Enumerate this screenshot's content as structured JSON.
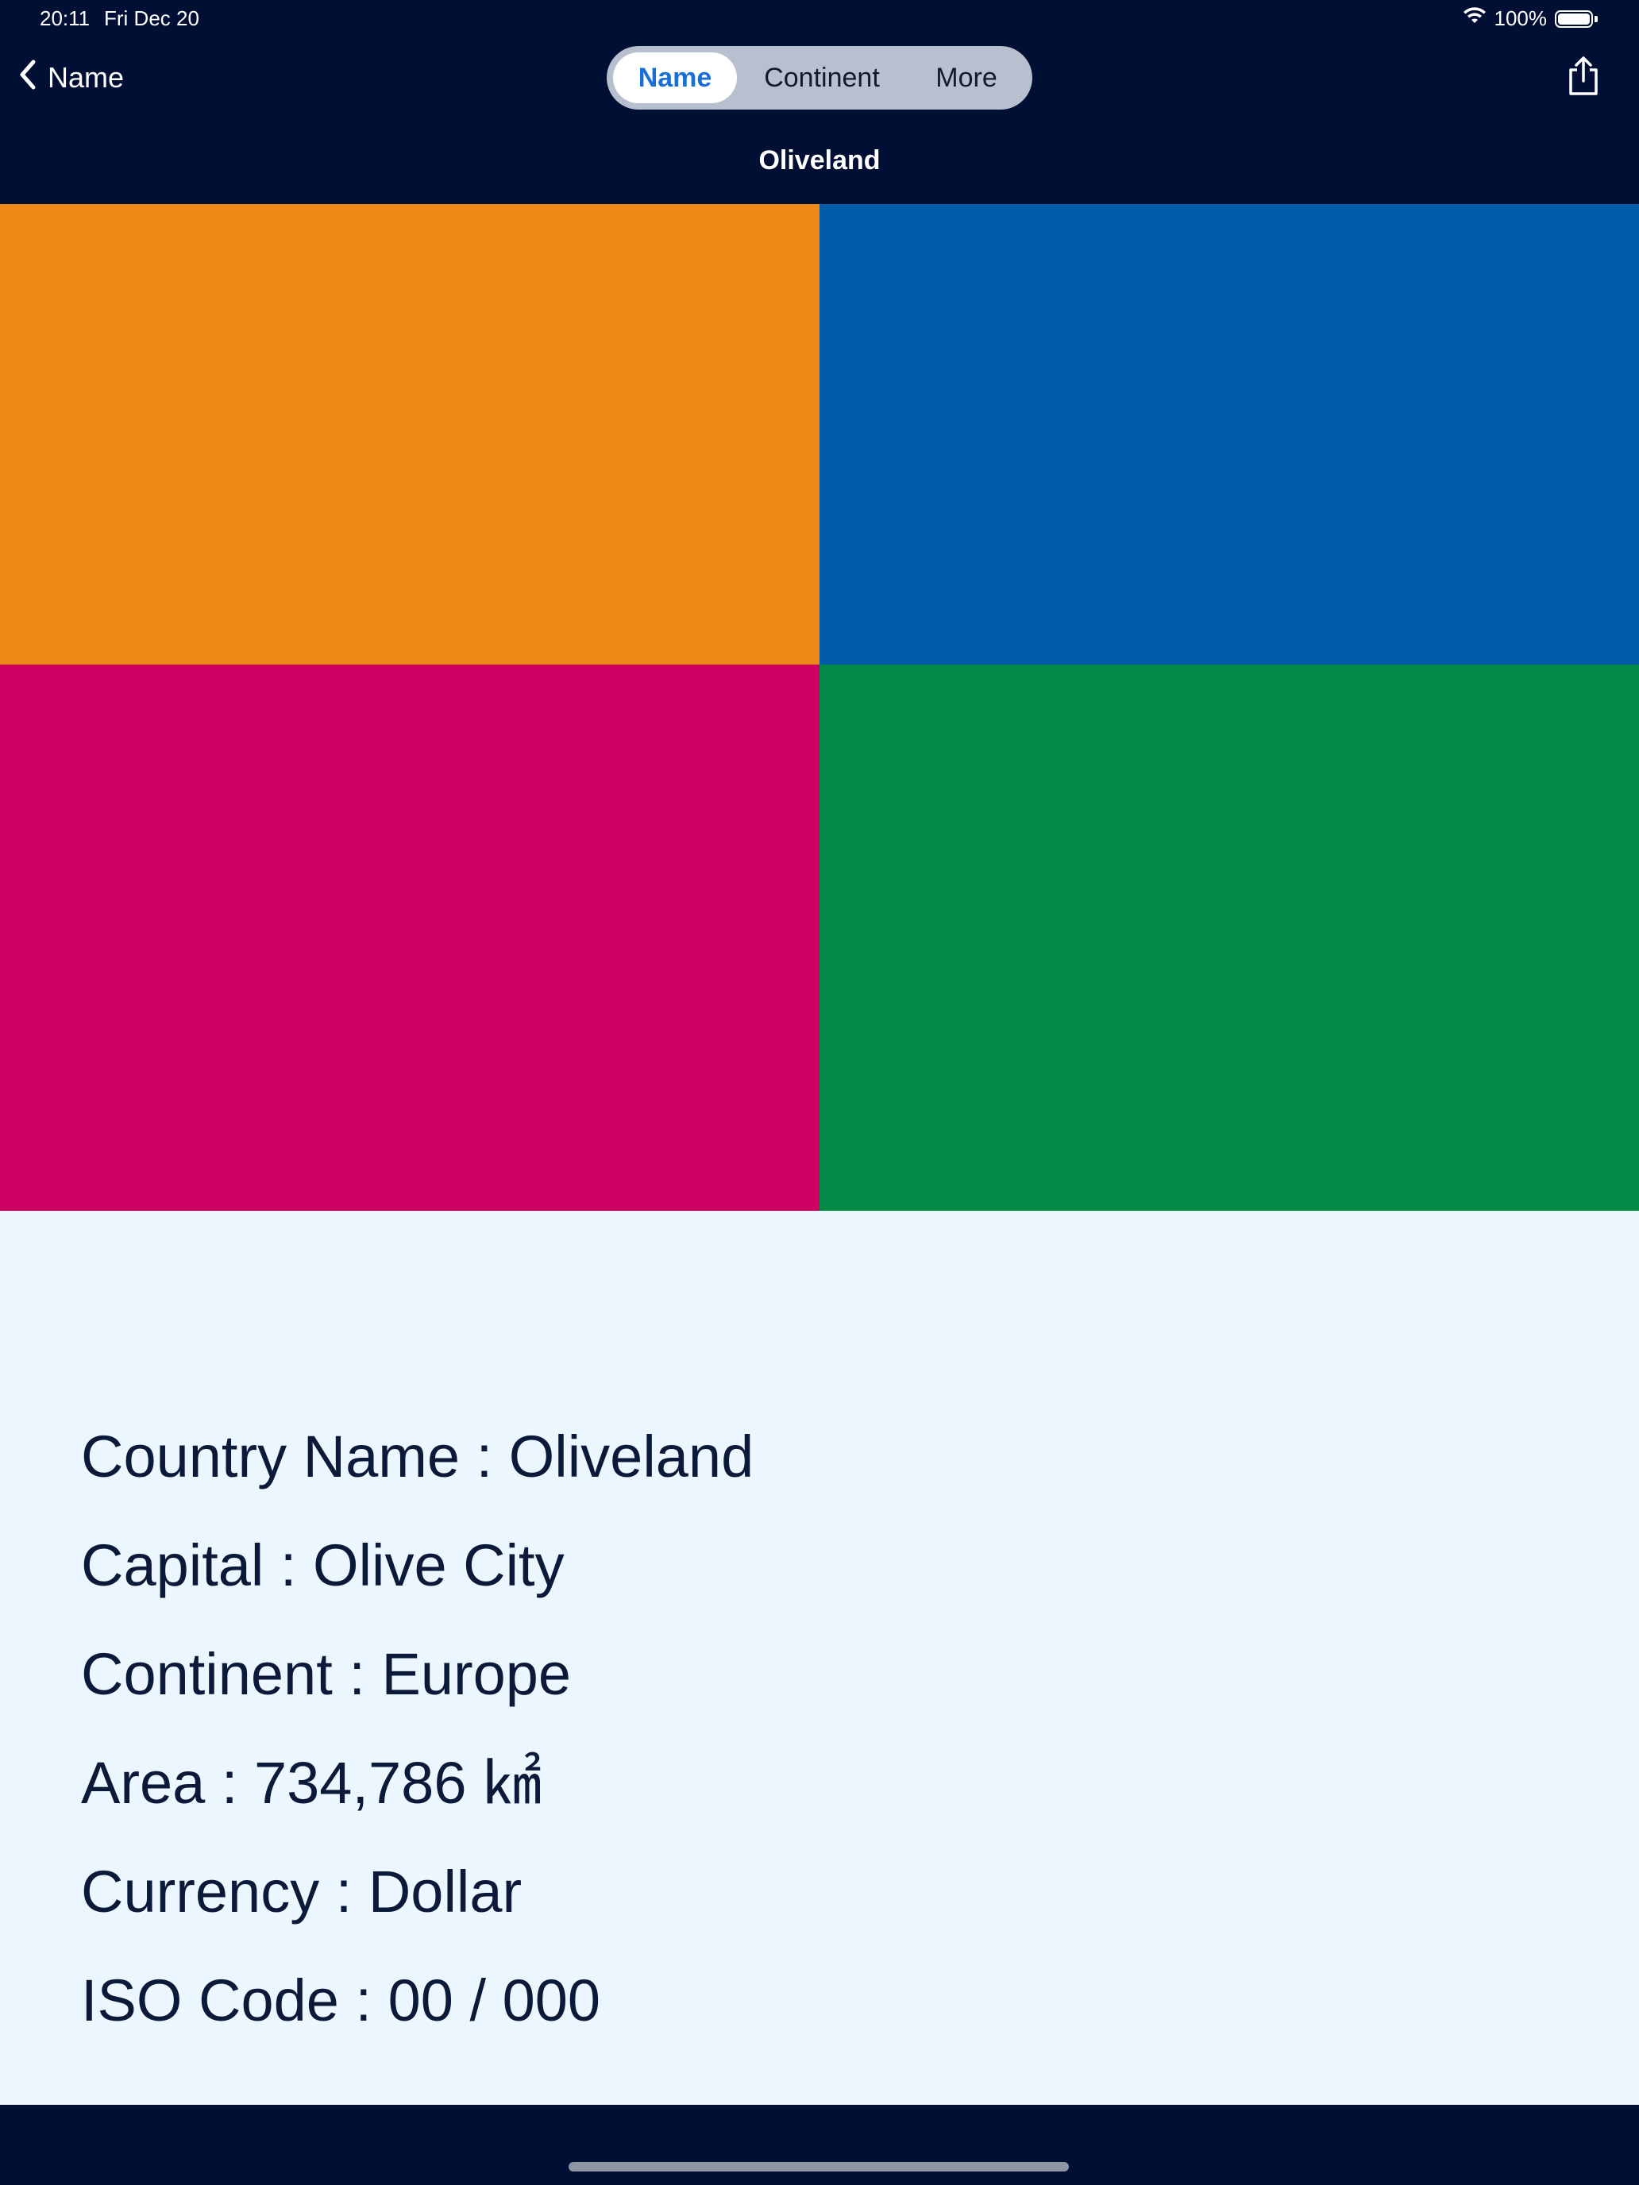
{
  "status_bar": {
    "time": "20:11",
    "date": "Fri Dec 20",
    "battery": "100%",
    "battery_level": 1.0
  },
  "nav": {
    "back_label": "Name",
    "segments": [
      {
        "label": "Name",
        "selected": true
      },
      {
        "label": "Continent",
        "selected": false
      },
      {
        "label": "More",
        "selected": false
      }
    ],
    "title": "Oliveland"
  },
  "flag": {
    "colors": {
      "top_left": "#f08a16",
      "top_right": "#005ba8",
      "bottom_left": "#cf0062",
      "bottom_right": "#008a45"
    }
  },
  "details": {
    "country_name": "Country Name : Oliveland",
    "capital": "Capital : Olive City",
    "continent": "Continent : Europe",
    "area": "Area : 734,786 ㎢",
    "currency": "Currency : Dollar",
    "iso_code": "ISO Code : 00 / 000"
  },
  "theme": {
    "nav_background": "#000f33",
    "panel_background": "#ebf6fe",
    "accent": "#1a6fd6",
    "text": "#0c1a3a"
  }
}
